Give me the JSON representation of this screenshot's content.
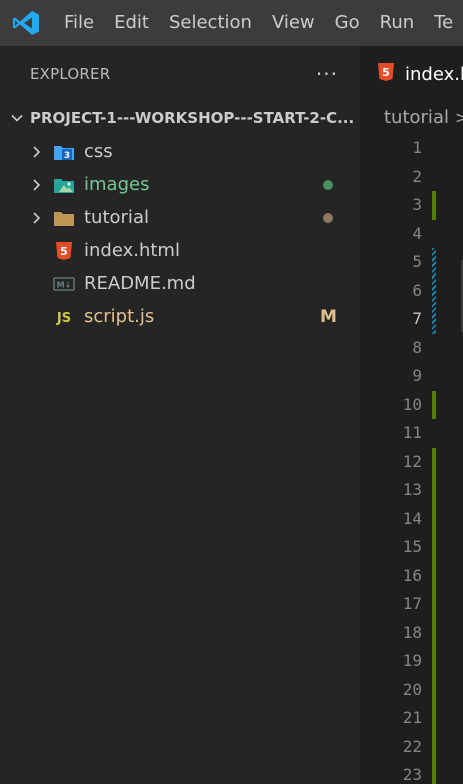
{
  "menu": [
    "File",
    "Edit",
    "Selection",
    "View",
    "Go",
    "Run",
    "Te"
  ],
  "explorer": {
    "title": "EXPLORER",
    "more": "···",
    "project": "PROJECT-1---WORKSHOP---START-2-C..."
  },
  "tree": [
    {
      "label": "css",
      "kind": "folder",
      "icon": "css-folder-icon",
      "color": "#cccccc"
    },
    {
      "label": "images",
      "kind": "folder",
      "icon": "images-folder-icon",
      "color": "#73c991",
      "status": "dot",
      "status_color": "#4b8e64"
    },
    {
      "label": "tutorial",
      "kind": "folder",
      "icon": "folder-icon",
      "color": "#cccccc",
      "status": "dot",
      "status_color": "#8b7a5e"
    },
    {
      "label": "index.html",
      "kind": "file",
      "icon": "html-file-icon",
      "color": "#cccccc"
    },
    {
      "label": "README.md",
      "kind": "file",
      "icon": "markdown-file-icon",
      "color": "#cccccc"
    },
    {
      "label": "script.js",
      "kind": "file",
      "icon": "js-file-icon",
      "color": "#e2c08d",
      "status": "M",
      "status_color": "#e2c08d"
    }
  ],
  "tab": {
    "label": "index.h"
  },
  "breadcrumb": {
    "part": "tutorial",
    "sep": ">"
  },
  "lines": [
    {
      "n": "1"
    },
    {
      "n": "2"
    },
    {
      "n": "3",
      "mark": "added"
    },
    {
      "n": "4"
    },
    {
      "n": "5",
      "mark": "modified"
    },
    {
      "n": "6",
      "mark": "modified"
    },
    {
      "n": "7",
      "mark": "modified",
      "active": true
    },
    {
      "n": "8"
    },
    {
      "n": "9"
    },
    {
      "n": "10",
      "mark": "added"
    },
    {
      "n": "11"
    },
    {
      "n": "12",
      "mark": "added"
    },
    {
      "n": "13",
      "mark": "added"
    },
    {
      "n": "14",
      "mark": "added"
    },
    {
      "n": "15",
      "mark": "added"
    },
    {
      "n": "16",
      "mark": "added"
    },
    {
      "n": "17",
      "mark": "added"
    },
    {
      "n": "18",
      "mark": "added"
    },
    {
      "n": "19",
      "mark": "added"
    },
    {
      "n": "20",
      "mark": "added"
    },
    {
      "n": "21",
      "mark": "added"
    },
    {
      "n": "22",
      "mark": "added"
    },
    {
      "n": "23",
      "mark": "added"
    }
  ],
  "colors": {
    "accent_logo": "#23a9f2",
    "git_added": "#587c0c",
    "git_modified": "#1b81a8"
  }
}
